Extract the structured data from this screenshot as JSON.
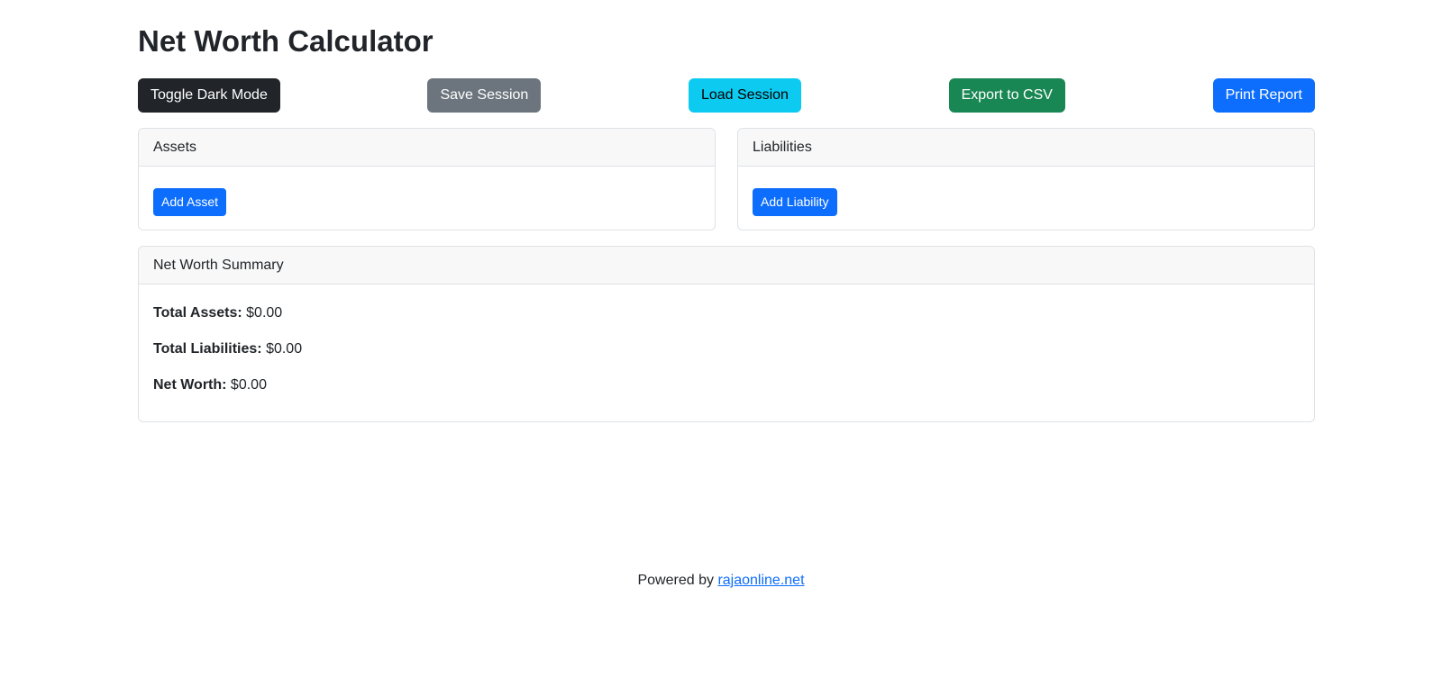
{
  "page": {
    "title": "Net Worth Calculator"
  },
  "toolbar": {
    "toggle_dark_mode": "Toggle Dark Mode",
    "save_session": "Save Session",
    "load_session": "Load Session",
    "export_csv": "Export to CSV",
    "print_report": "Print Report"
  },
  "assets": {
    "header": "Assets",
    "add_button": "Add Asset"
  },
  "liabilities": {
    "header": "Liabilities",
    "add_button": "Add Liability"
  },
  "summary": {
    "header": "Net Worth Summary",
    "total_assets_label": "Total Assets:",
    "total_assets_value": "$0.00",
    "total_liabilities_label": "Total Liabilities:",
    "total_liabilities_value": "$0.00",
    "net_worth_label": "Net Worth:",
    "net_worth_value": "$0.00"
  },
  "footer": {
    "powered_by": "Powered by",
    "link_text": "rajaonline.net"
  },
  "colors": {
    "dark": "#212529",
    "secondary": "#6c757d",
    "info": "#0dcaf0",
    "success": "#198754",
    "primary": "#0d6efd"
  }
}
